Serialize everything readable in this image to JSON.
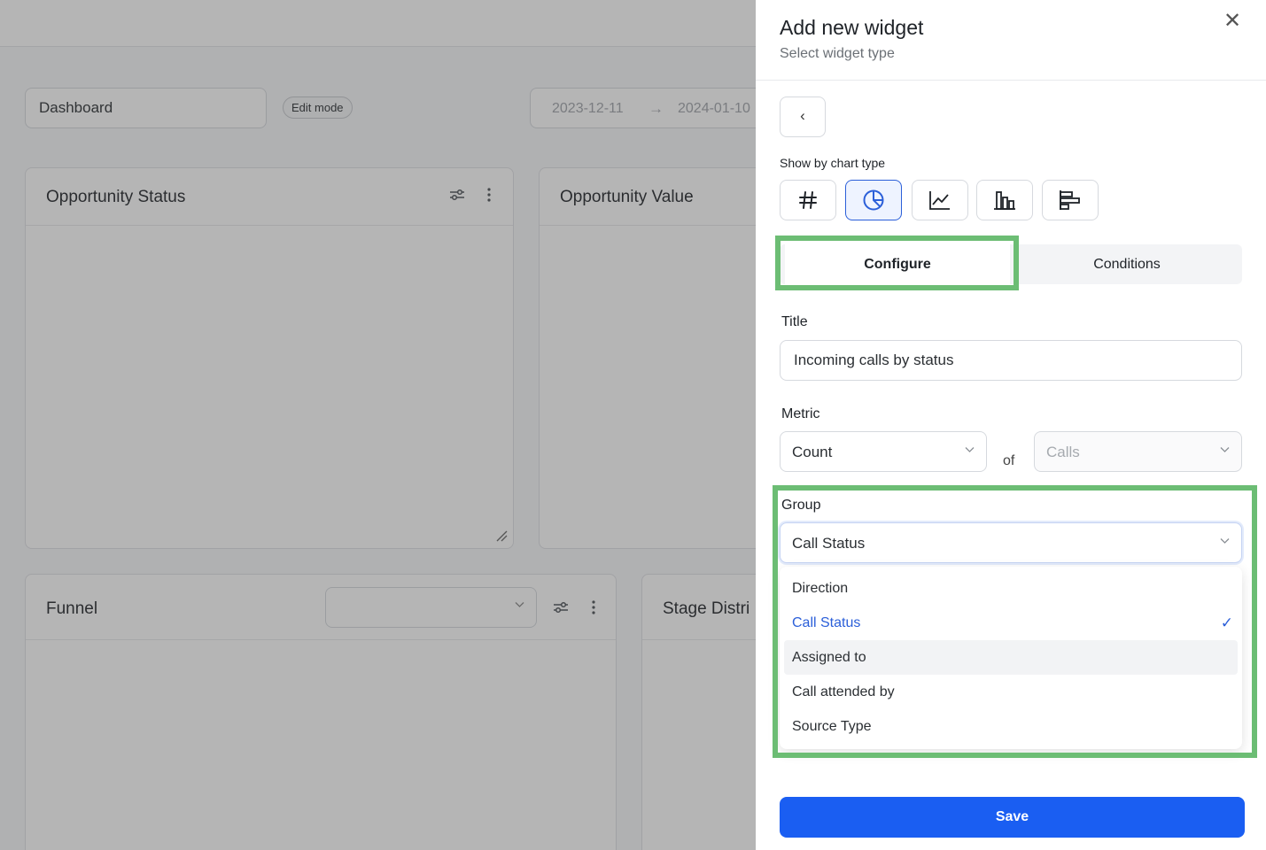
{
  "dashboard": {
    "name_value": "Dashboard",
    "edit_mode_label": "Edit mode",
    "date_from": "2023-12-11",
    "date_arrow": "→",
    "date_to": "2024-01-10",
    "cards": [
      {
        "title": "Opportunity Status"
      },
      {
        "title": "Opportunity Value"
      },
      {
        "title": "Funnel"
      },
      {
        "title": "Stage Distri"
      }
    ]
  },
  "panel": {
    "title": "Add new widget",
    "subtitle": "Select widget type",
    "close_icon": "✕",
    "back_icon": "‹",
    "chart_type_label": "Show by chart type",
    "chart_types": [
      {
        "name": "number",
        "icon": "hash-icon"
      },
      {
        "name": "pie",
        "icon": "pie-chart-icon",
        "active": true
      },
      {
        "name": "line",
        "icon": "line-chart-icon"
      },
      {
        "name": "column",
        "icon": "column-chart-icon"
      },
      {
        "name": "bar",
        "icon": "bar-chart-icon"
      }
    ],
    "tabs": {
      "configure": "Configure",
      "conditions": "Conditions"
    },
    "form": {
      "title_label": "Title",
      "title_value": "Incoming calls by status",
      "metric_label": "Metric",
      "metric_value": "Count",
      "of_label": "of",
      "entity_value": "Calls",
      "group_label": "Group",
      "group_value": "Call Status"
    },
    "group_options": [
      {
        "label": "Direction"
      },
      {
        "label": "Call Status",
        "selected": true
      },
      {
        "label": "Assigned to",
        "hover": true
      },
      {
        "label": "Call attended by"
      },
      {
        "label": "Source Type"
      }
    ],
    "check_icon": "✓",
    "save_label": "Save"
  },
  "colors": {
    "accent": "#1a5ef2",
    "selected_text": "#2b5fd9",
    "highlight_box": "#6cbd74"
  }
}
